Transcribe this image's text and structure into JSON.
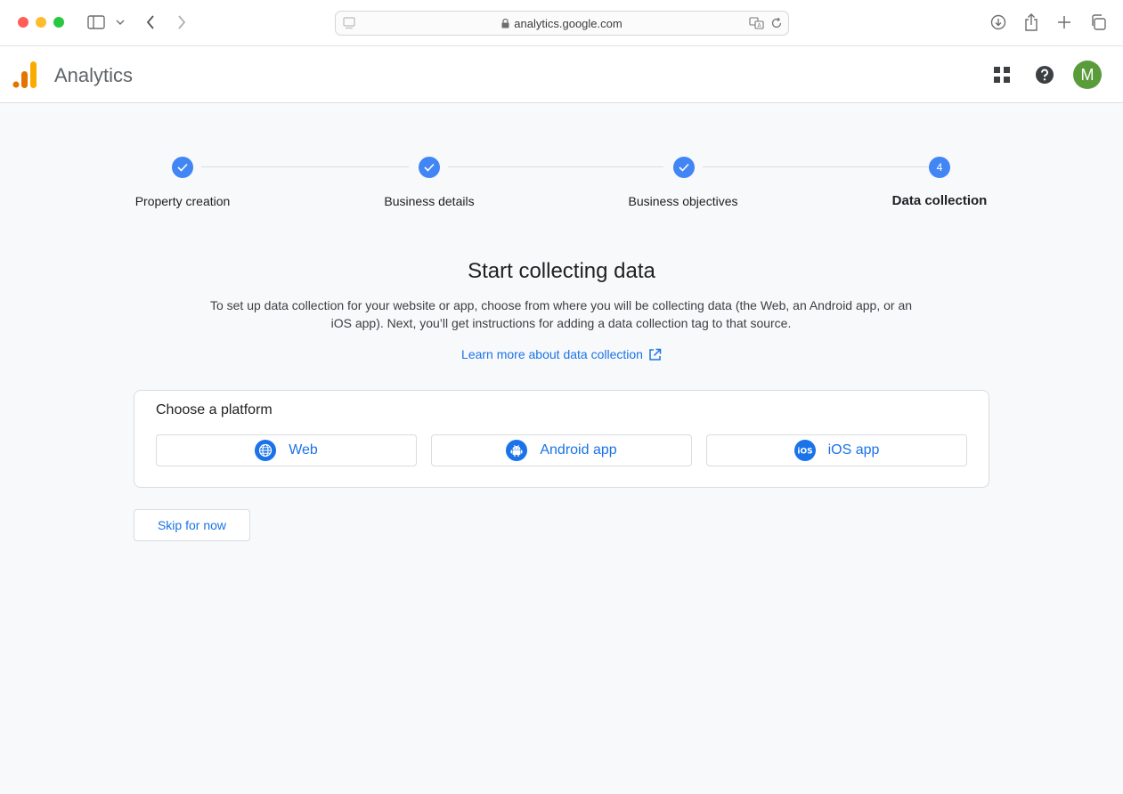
{
  "browser": {
    "url": "analytics.google.com"
  },
  "header": {
    "app_title": "Analytics",
    "avatar_initial": "M"
  },
  "stepper": {
    "steps": [
      {
        "label": "Property creation",
        "status": "done"
      },
      {
        "label": "Business details",
        "status": "done"
      },
      {
        "label": "Business objectives",
        "status": "done"
      },
      {
        "label": "Data collection",
        "status": "active",
        "number": "4"
      }
    ]
  },
  "main": {
    "heading": "Start collecting data",
    "description": "To set up data collection for your website or app, choose from where you will be collecting data (the Web, an Android app, or an iOS app). Next, you’ll get instructions for adding a data collection tag to that source.",
    "learn_more": "Learn more about data collection"
  },
  "platform_card": {
    "title": "Choose a platform",
    "options": [
      {
        "label": "Web",
        "icon": "globe-icon"
      },
      {
        "label": "Android app",
        "icon": "android-icon"
      },
      {
        "label": "iOS app",
        "icon": "ios-icon",
        "icon_text": "iOS"
      }
    ]
  },
  "skip_label": "Skip for now",
  "colors": {
    "accent": "#1a73e8",
    "step": "#4285f4",
    "avatar": "#5a9c3a",
    "logo_orange": "#e37400",
    "logo_yellow": "#f9ab00"
  }
}
